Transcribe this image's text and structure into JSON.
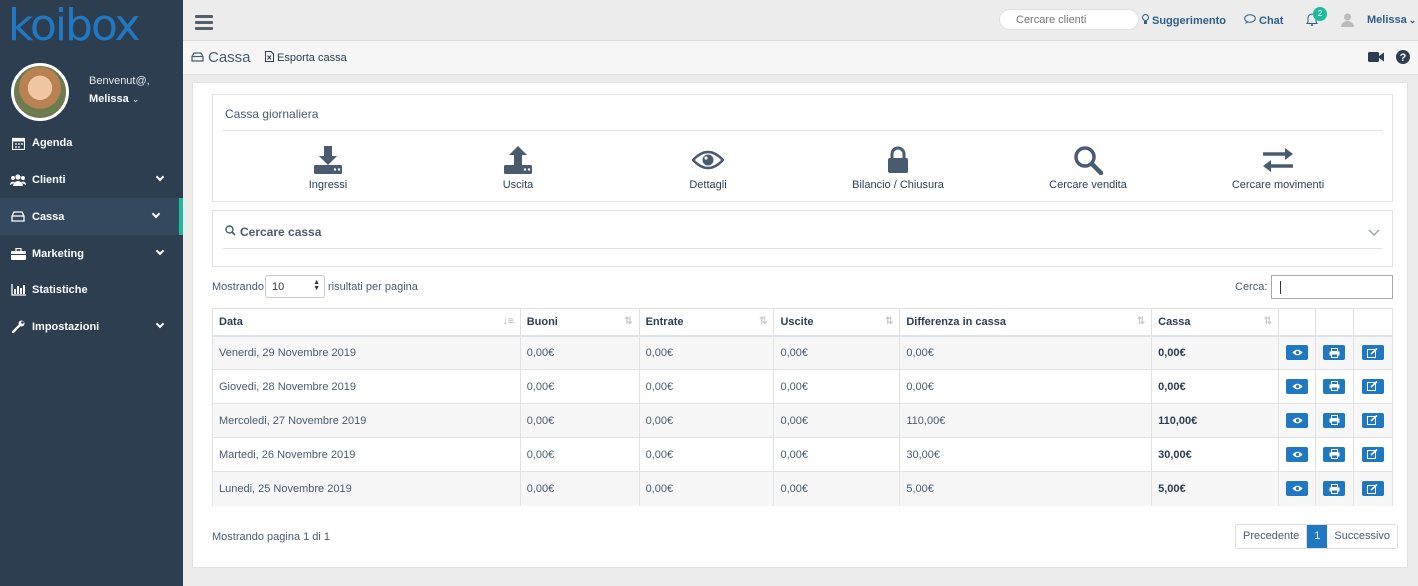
{
  "brand": {
    "logo": "koibox",
    "accent": "#1f78c1",
    "sidebar_bg": "#2c3e50",
    "active_marker": "#1abc9c"
  },
  "user": {
    "welcome": "Benvenut@,",
    "name": "Melissa"
  },
  "sidebar": {
    "items": [
      {
        "label": "Agenda",
        "icon": "calendar-icon"
      },
      {
        "label": "Clienti",
        "icon": "users-icon"
      },
      {
        "label": "Cassa",
        "icon": "cash-drawer-icon"
      },
      {
        "label": "Marketing",
        "icon": "briefcase-icon"
      },
      {
        "label": "Statistiche",
        "icon": "bar-chart-icon"
      },
      {
        "label": "Impostazioni",
        "icon": "wrench-icon"
      }
    ]
  },
  "topbar": {
    "search_placeholder": "Cercare clienti",
    "suggest": "Suggerimento",
    "chat": "Chat",
    "notifications": "2",
    "user": "Melissa"
  },
  "subheader": {
    "title": "Cassa",
    "export": "Esporta cassa"
  },
  "daily": {
    "title": "Cassa giornaliera",
    "actions": [
      {
        "label": "Ingressi",
        "icon": "download-icon"
      },
      {
        "label": "Uscita",
        "icon": "upload-icon"
      },
      {
        "label": "Dettagli",
        "icon": "eye-icon"
      },
      {
        "label": "Bilancio / Chiusura",
        "icon": "lock-icon"
      },
      {
        "label": "Cercare vendita",
        "icon": "search-icon"
      },
      {
        "label": "Cercare movimenti",
        "icon": "exchange-icon"
      }
    ]
  },
  "search_box": {
    "title": "Cercare cassa"
  },
  "table_controls": {
    "showing": "Mostrando",
    "per_page": "10",
    "per_page_suffix": "risultati per pagina",
    "search_label": "Cerca:"
  },
  "table": {
    "headers": [
      "Data",
      "Buoni",
      "Entrate",
      "Uscite",
      "Differenza in cassa",
      "Cassa"
    ],
    "rows": [
      [
        "Venerdi, 29 Novembre 2019",
        "0,00€",
        "0,00€",
        "0,00€",
        "0,00€",
        "0,00€"
      ],
      [
        "Giovedi, 28 Novembre 2019",
        "0,00€",
        "0,00€",
        "0,00€",
        "0,00€",
        "0,00€"
      ],
      [
        "Mercoledi, 27 Novembre 2019",
        "0,00€",
        "0,00€",
        "0,00€",
        "110,00€",
        "110,00€"
      ],
      [
        "Martedi, 26 Novembre 2019",
        "0,00€",
        "0,00€",
        "0,00€",
        "30,00€",
        "30,00€"
      ],
      [
        "Lunedi, 25 Novembre 2019",
        "0,00€",
        "0,00€",
        "0,00€",
        "5,00€",
        "5,00€"
      ]
    ]
  },
  "footer": {
    "info": "Mostrando pagina 1 di 1",
    "prev": "Precedente",
    "page": "1",
    "next": "Successivo"
  }
}
